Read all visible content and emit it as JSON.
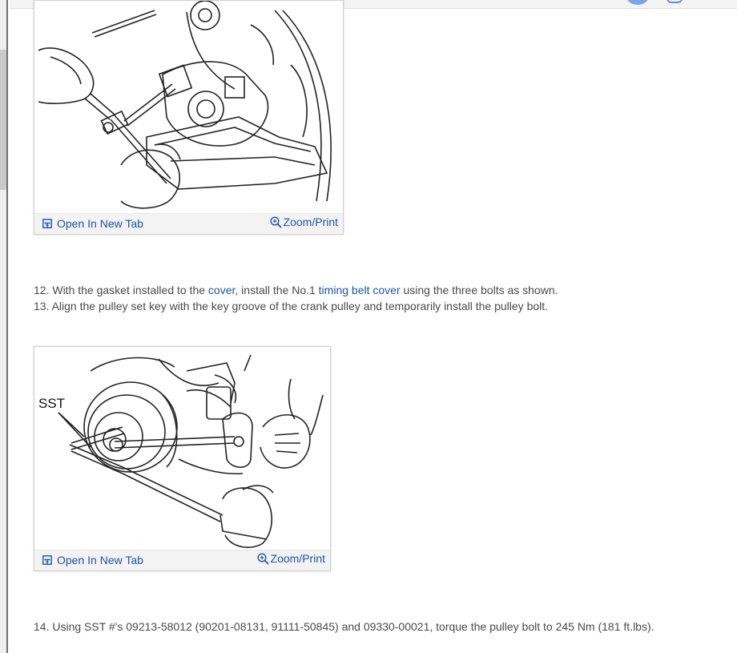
{
  "figures": [
    {
      "open_label": "Open In New Tab",
      "zoom_label": "Zoom/Print"
    },
    {
      "open_label": "Open In New Tab",
      "zoom_label": "Zoom/Print",
      "callout": "SST"
    }
  ],
  "steps": {
    "s12": {
      "num": "12.",
      "t1": " With the gasket installed to the ",
      "link1": "cover",
      "t2": ", install the No.1 ",
      "link2": "timing belt cover",
      "t3": " using the three bolts as shown."
    },
    "s13": {
      "num": "13.",
      "text": " Align the pulley set key with the key groove of the crank pulley and temporarily install the pulley bolt."
    },
    "s14": {
      "num": "14.",
      "text": " Using SST #'s 09213-58012 (90201-08131, 91111-50845) and 09330-00021, torque the pulley bolt to 245 Nm (181 ft.lbs)."
    }
  },
  "colors": {
    "link": "#1e55a3",
    "text": "#4a4a4a"
  },
  "icons": [
    "open-in-new-tab-icon",
    "zoom-in-icon"
  ]
}
